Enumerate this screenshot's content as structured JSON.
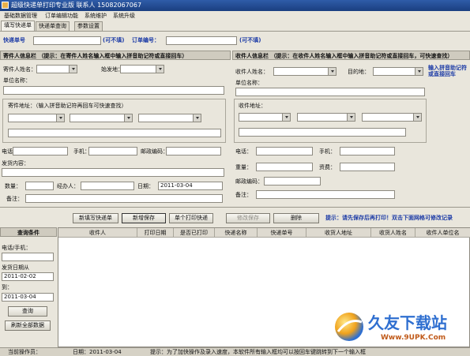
{
  "window": {
    "title": "超级快递单打印专业版 联系人 15082067067"
  },
  "menu": [
    "基础数据管理",
    "订单编辑功能",
    "系统维护",
    "系统升级"
  ],
  "tabs": [
    "填写快递单",
    "快递单查询",
    "参数设置"
  ],
  "top": {
    "express_no_label": "快递单号",
    "express_optional": "(可不填)",
    "order_no_label": "订单编号：",
    "order_optional": "(可不填)"
  },
  "sender": {
    "header": "寄件人信息栏",
    "hint": "（提示：在寄件人姓名输入框中输入拼音助记符或直接回车）",
    "name_label": "寄件人姓名：",
    "origin_label": "始发地：",
    "company_label": "单位名称：",
    "address_label": "寄件地址：（输入拼音助记符再回车可快速查找）",
    "phone_label": "电话：",
    "mobile_label": "手机：",
    "postcode_label": "邮政编码：",
    "content_label": "发货内容：",
    "qty_label": "数量：",
    "handler_label": "经办人：",
    "date_label": "日期：",
    "date_value": "2011-03-04",
    "remark_label": "备注："
  },
  "receiver": {
    "header": "收件人信息栏",
    "hint": "（提示：在收件人姓名输入框中输入拼音助记符或直接回车，可快速查找）",
    "name_label": "收件人姓名：",
    "dest_label": "目的地：",
    "side_hint": "输入拼音助记符或直接回车",
    "company_label": "单位名称：",
    "address_label": "收件地址：",
    "phone_label": "电话：",
    "mobile_label": "手机：",
    "weight_label": "重量：",
    "fee_label": "资费：",
    "postcode_label": "邮政编码：",
    "remark_label": "备注："
  },
  "buttons": {
    "new": "新填写快递单",
    "save": "新增保存",
    "print": "单个打印快递",
    "modify": "修改保存",
    "delete": "删除"
  },
  "action_hint": "提示：请先保存后再打印！双击下面网格可修改记录",
  "query": {
    "header": "查询条件",
    "phone_label": "电话/手机：",
    "start_label": "发货日期从",
    "start_value": "2011-02-02",
    "end_label": "到：",
    "end_value": "2011-03-04",
    "query_button": "查询",
    "refresh_button": "刷新全部数据"
  },
  "grid": {
    "columns": [
      "收件人",
      "打印日期",
      "是否已打印",
      "快递名称",
      "快递单号",
      "收货人地址",
      "收货人姓名",
      "收件人单位名"
    ]
  },
  "status": {
    "operator": "当前操作员：",
    "date": "日期：2011-03-04",
    "tip": "提示：为了加快操作及录入速度，本软件所有输入框均可以按回车键跳转到下一个输入框"
  },
  "watermark": {
    "text": "久友下载站",
    "url": "Www.9UPK.Com"
  },
  "colors": {
    "title": "#1a3f80",
    "accent": "#1b3aa6",
    "background": "#e9e6dc"
  }
}
